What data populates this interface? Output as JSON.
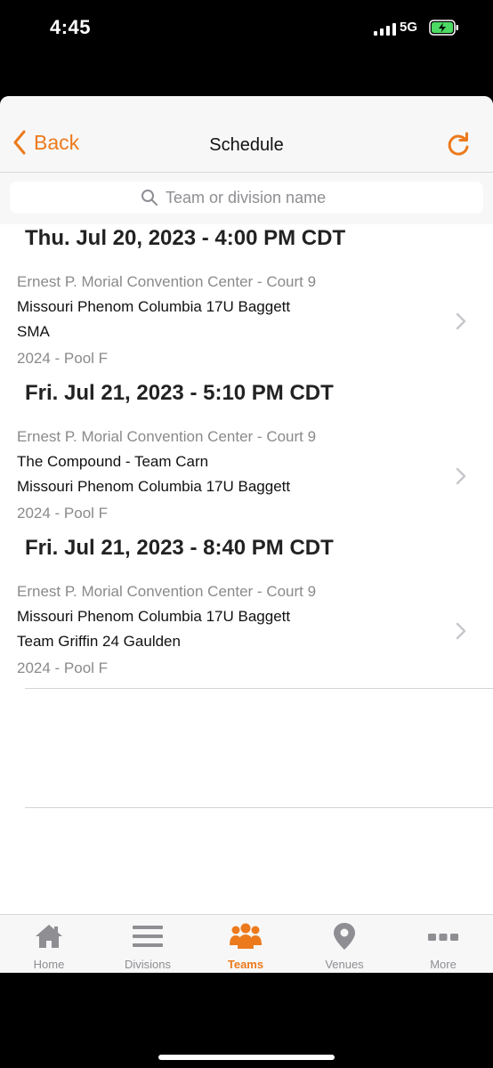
{
  "status": {
    "time": "4:45",
    "network": "5G"
  },
  "nav": {
    "back_label": "Back",
    "title": "Schedule"
  },
  "search": {
    "placeholder": "Team or division name",
    "value": ""
  },
  "games": [
    {
      "datetime": "Thu. Jul 20, 2023 - 4:00 PM CDT",
      "venue": "Ernest P. Morial Convention Center - Court 9",
      "team1": "Missouri Phenom Columbia 17U Baggett",
      "team2": "SMA",
      "division": "2024 - Pool F"
    },
    {
      "datetime": "Fri. Jul 21, 2023 - 5:10 PM CDT",
      "venue": "Ernest P. Morial Convention Center - Court 9",
      "team1": "The Compound - Team Carn",
      "team2": "Missouri Phenom Columbia 17U Baggett",
      "division": "2024 - Pool F"
    },
    {
      "datetime": "Fri. Jul 21, 2023 - 8:40 PM CDT",
      "venue": "Ernest P. Morial Convention Center - Court 9",
      "team1": "Missouri Phenom Columbia 17U Baggett",
      "team2": "Team Griffin 24 Gaulden",
      "division": "2024 - Pool F"
    }
  ],
  "tabs": [
    {
      "label": "Home",
      "icon": "home-icon",
      "active": false
    },
    {
      "label": "Divisions",
      "icon": "list-icon",
      "active": false
    },
    {
      "label": "Teams",
      "icon": "teams-icon",
      "active": true
    },
    {
      "label": "Venues",
      "icon": "location-pin-icon",
      "active": false
    },
    {
      "label": "More",
      "icon": "more-dots-icon",
      "active": false
    }
  ],
  "colors": {
    "accent": "#ec7a1c",
    "inactive": "#8e8e93",
    "secondary_text": "#8a8a8a"
  }
}
